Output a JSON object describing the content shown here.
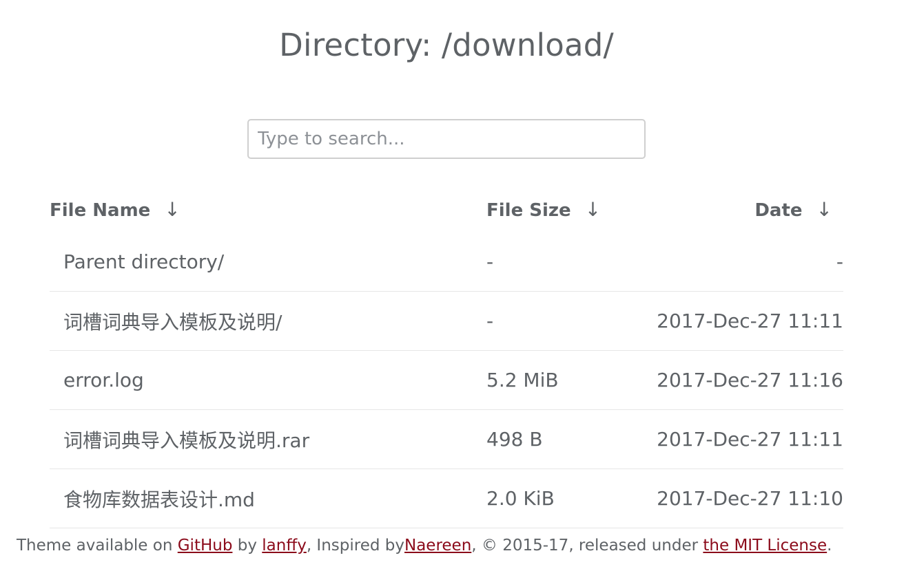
{
  "page": {
    "title": "Directory: /download/"
  },
  "search": {
    "placeholder": "Type to search..."
  },
  "table": {
    "columns": [
      {
        "label": "File Name",
        "sort_icon": "↓"
      },
      {
        "label": "File Size",
        "sort_icon": "↓"
      },
      {
        "label": "Date",
        "sort_icon": "↓"
      }
    ],
    "rows": [
      {
        "name": "Parent directory/",
        "size": "-",
        "date": "-"
      },
      {
        "name": "词槽词典导入模板及说明/",
        "size": "-",
        "date": "2017-Dec-27 11:11"
      },
      {
        "name": "error.log",
        "size": "5.2 MiB",
        "date": "2017-Dec-27 11:16"
      },
      {
        "name": "词槽词典导入模板及说明.rar",
        "size": "498 B",
        "date": "2017-Dec-27 11:11"
      },
      {
        "name": "食物库数据表设计.md",
        "size": "2.0 KiB",
        "date": "2017-Dec-27 11:10"
      }
    ]
  },
  "footer": {
    "text_1": "Theme available on ",
    "link_github": "GitHub",
    "text_2": " by ",
    "link_lanffy": "lanffy",
    "text_3": ", Inspired by",
    "link_naereen": "Naereen",
    "text_4": ", © 2015-17, released under ",
    "link_license": "the MIT License",
    "text_5": "."
  },
  "colors": {
    "text": "#5e6266",
    "link": "#8b0a1a",
    "divider": "#e6e6e6",
    "input_border": "#cfcfcf"
  }
}
